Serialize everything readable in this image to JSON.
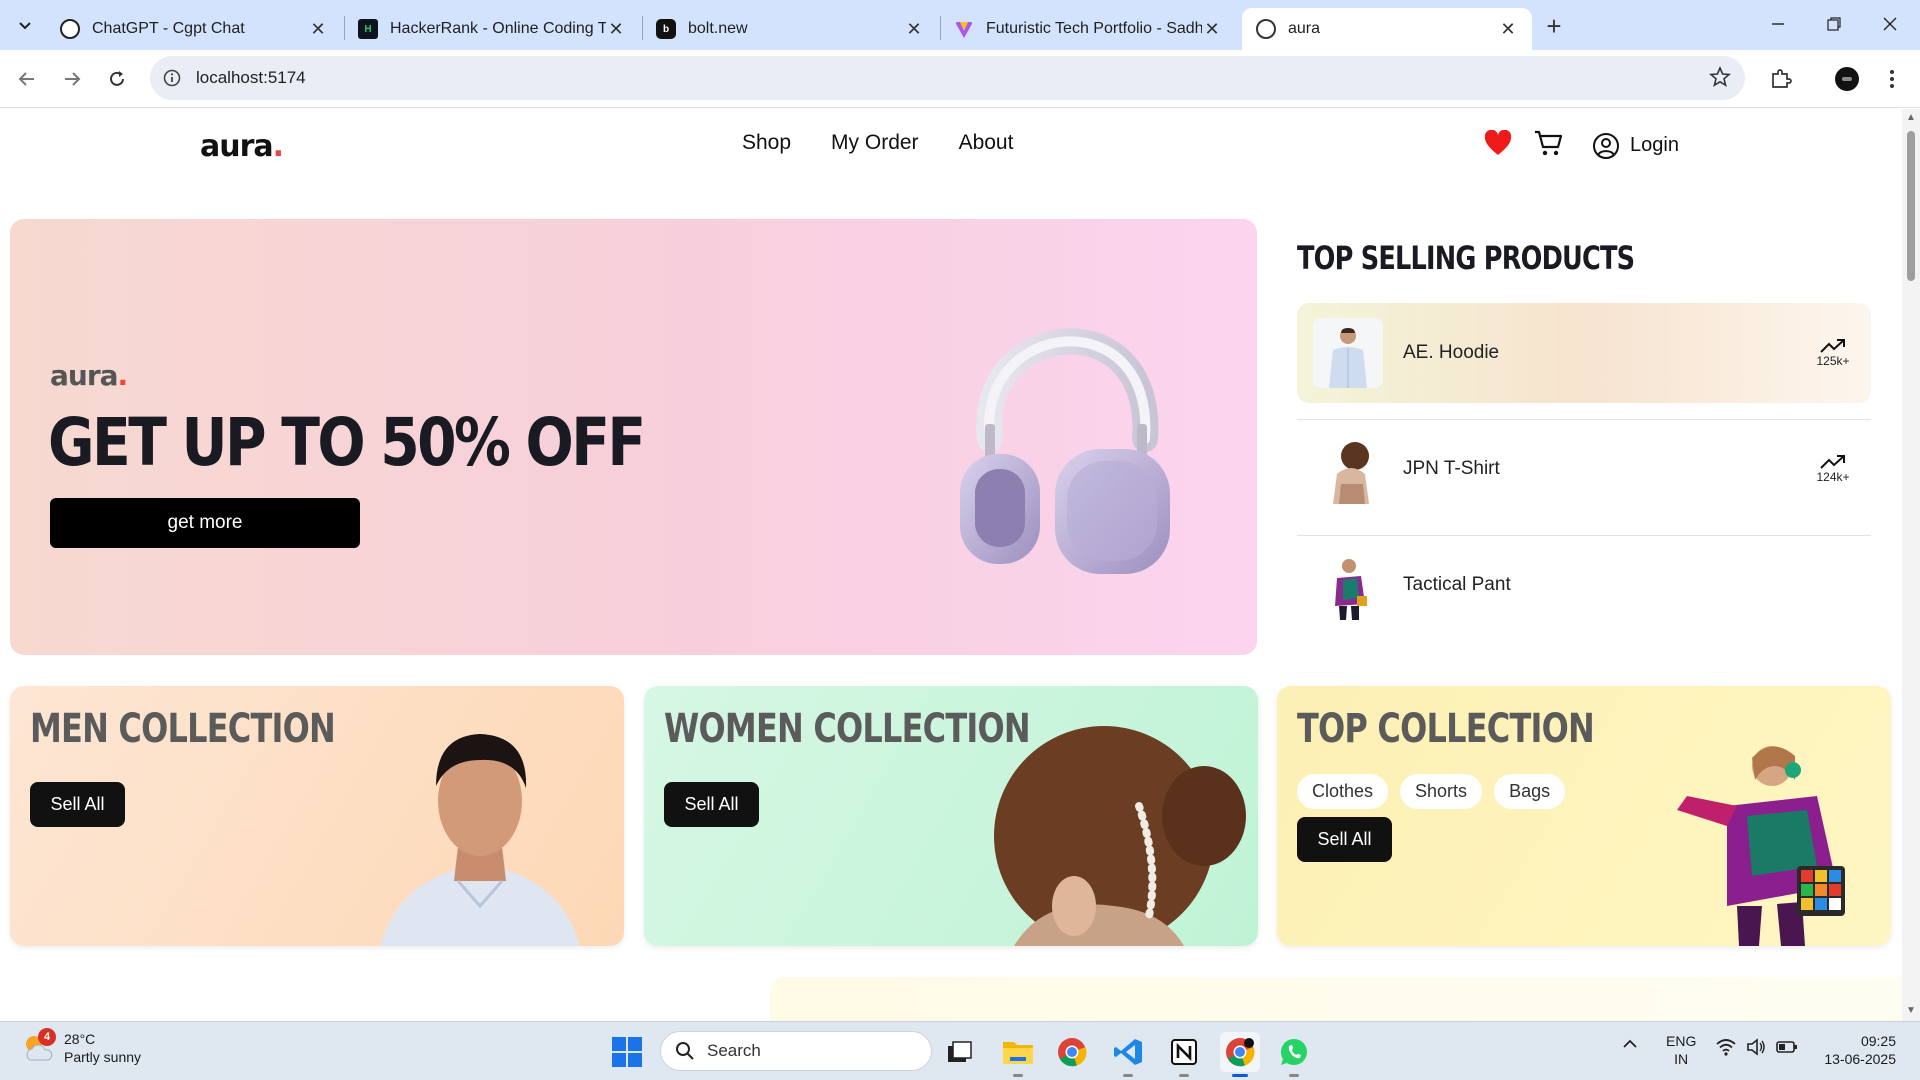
{
  "browser": {
    "tabs": [
      {
        "title": "ChatGPT - Cgpt Chat",
        "icon": "chatgpt-icon"
      },
      {
        "title": "HackerRank - Online Coding Te",
        "icon": "hackerrank-icon"
      },
      {
        "title": "bolt.new",
        "icon": "bolt-icon"
      },
      {
        "title": "Futuristic Tech Portfolio - Sadha",
        "icon": "vite-icon"
      },
      {
        "title": "aura",
        "icon": "aura-icon",
        "active": true
      }
    ],
    "url": "localhost:5174"
  },
  "site": {
    "logo": "aura",
    "logo_dot": ".",
    "nav": [
      "Shop",
      "My Order",
      "About"
    ],
    "login_label": "Login"
  },
  "hero": {
    "brand": "aura",
    "brand_dot": ".",
    "title": "GET UP TO 50% OFF",
    "button_label": "get more"
  },
  "top_selling": {
    "title": "TOP SELLING PRODUCTS",
    "items": [
      {
        "name": "AE. Hoodie",
        "count": "125k+"
      },
      {
        "name": "JPN T-Shirt",
        "count": "124k+"
      },
      {
        "name": "Tactical Pant",
        "count": ""
      }
    ]
  },
  "collections": [
    {
      "title": "MEN COLLECTION",
      "button_label": "Sell All"
    },
    {
      "title": "WOMEN COLLECTION",
      "button_label": "Sell All"
    },
    {
      "title": "TOP COLLECTION",
      "button_label": "Sell All",
      "chips": [
        "Clothes",
        "Shorts",
        "Bags"
      ]
    }
  ],
  "taskbar": {
    "weather_badge": "4",
    "temperature": "28°C",
    "weather_desc": "Partly sunny",
    "search_placeholder": "Search",
    "lang_line1": "ENG",
    "lang_line2": "IN",
    "time": "09:25",
    "date": "13-06-2025"
  },
  "colors": {
    "accent_red": "#ef4444",
    "hero_gradient_start": "#f7d9d0",
    "hero_gradient_end": "#fcd4ef",
    "men_bg": "#fde3cf",
    "women_bg": "#c9f5dc",
    "top_bg": "#fdf3b8"
  }
}
